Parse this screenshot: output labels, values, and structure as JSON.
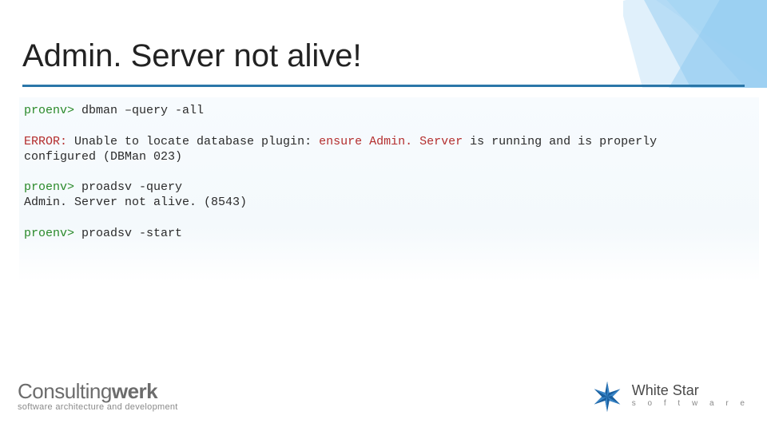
{
  "title": "Admin. Server not alive!",
  "terminal": {
    "b1": {
      "prompt": "proenv>",
      "cmd": " dbman –query -all"
    },
    "b2": {
      "err": "ERROR:",
      "msg1": " Unable to locate database plugin: ",
      "red": "ensure Admin. Server",
      "msg2": " is running and is properly",
      "msg3": "configured (DBMan 023)"
    },
    "b3": {
      "prompt": "proenv>",
      "cmd": " proadsv -query",
      "out": "Admin. Server not alive. (8543)"
    },
    "b4": {
      "prompt": "proenv>",
      "cmd": " proadsv -start"
    }
  },
  "footer": {
    "left": {
      "part1": "Consulting",
      "part2": "werk",
      "sub": "software architecture and development"
    },
    "right": {
      "l1": "White Star",
      "l2": "s o f t w a r e"
    }
  }
}
